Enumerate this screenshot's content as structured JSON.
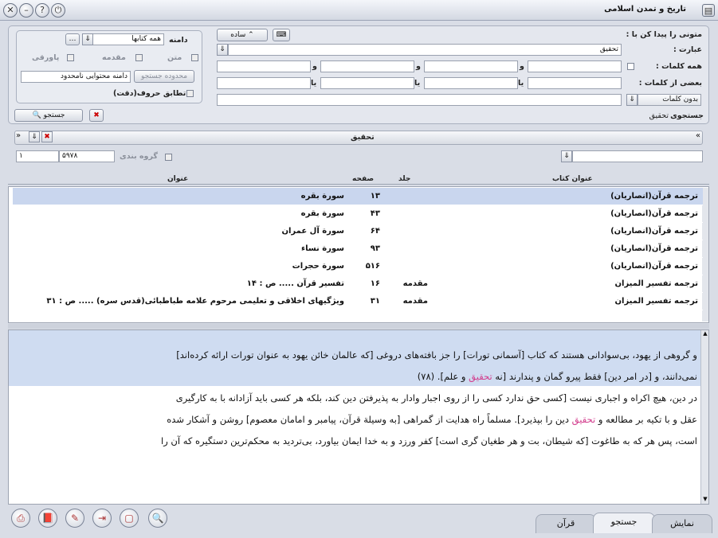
{
  "window": {
    "title": "تاریخ و تمدن اسلامی"
  },
  "search": {
    "find_texts_label": "متونی را پیدا کن با :",
    "simple_button": "ساده",
    "phrase_label": "عبارت :",
    "phrase_value": "تحقیق",
    "all_words_label": "همه کلمات :",
    "some_words_label": "بعضی از کلمات :",
    "without_words_label": "بدون کلمات",
    "and_word": "و",
    "or_word": "یا",
    "search_of_label": "جستجوی",
    "search_of_value": "تحقیق",
    "search_button": "جستجو"
  },
  "scope": {
    "scope_label": "دامنه",
    "scope_value": "همه کتابها",
    "text_label": "متن",
    "intro_label": "مقدمه",
    "footnote_label": "پاورقی",
    "limit_button": "محدوده جستجو",
    "content_scope": "دامنه محتوایی نامحدود",
    "exact_match_label": "تطابق حروف(دقت)"
  },
  "results": {
    "query_title": "تحقیق",
    "group_label": "گروه بندی",
    "count": "۵۹۷۸",
    "page": "۱",
    "headers": {
      "book_title": "عنوان کتاب",
      "volume": "جلد",
      "page": "صفحه",
      "title": "عنوان"
    },
    "rows": [
      {
        "book": "ترجمه قرآن(انصاریان)",
        "volume": "",
        "page": "۱۳",
        "title": "سورة بقره"
      },
      {
        "book": "ترجمه قرآن(انصاریان)",
        "volume": "",
        "page": "۴۳",
        "title": "سورة بقره"
      },
      {
        "book": "ترجمه قرآن(انصاریان)",
        "volume": "",
        "page": "۶۴",
        "title": "سورة آل عمران"
      },
      {
        "book": "ترجمه قرآن(انصاریان)",
        "volume": "",
        "page": "۹۳",
        "title": "سورة نساء"
      },
      {
        "book": "ترجمه قرآن(انصاریان)",
        "volume": "",
        "page": "۵۱۶",
        "title": "سورة حجرات"
      },
      {
        "book": "ترجمه تفسیر المیزان",
        "volume": "مقدمه",
        "page": "۱۶",
        "title": "تفسیر قرآن ..... ص : ۱۴"
      },
      {
        "book": "ترجمه تفسیر المیزان",
        "volume": "مقدمه",
        "page": "۳۱",
        "title": "ویژگیهای اخلاقی و تعلیمی مرحوم علامه طباطبائی(قدس سره) ..... ص : ۳۱"
      }
    ]
  },
  "preview": {
    "p1a": "و گروهی از یهود، بی‌سوادانی هستند که کتاب [آسمانی تورات] را جز بافته‌های دروغی [که عالمان خائن یهود به عنوان تورات ارائه کرده‌اند]",
    "p1b_pre": "نمی‌دانند، و [در امر دین] فقط پیرو گمان و پندارند [نه",
    "p1b_hl": "تحقیق",
    "p1b_post": "و علم]. (۷۸)",
    "p2a": "در دین، هیچ اکراه و اجباری نیست [کسی حق ندارد کسی را از روی اجبار وادار به پذیرفتن دین کند، بلکه هر کسی باید آزادانه با به کارگیری",
    "p2b_pre": "عقل و با تکیه بر مطالعه و",
    "p2b_hl": "تحقیق",
    "p2b_post": "دین را بپذیرد]. مسلماً راه هدایت از گمراهی [به وسیلة قرآن، پیامبر و امامان معصوم] روشن و آشکار شده",
    "p2c": "است، پس هر که به طاغوت [که شیطان، بت و هر طغیان گری است] کفر ورزد و به خدا ایمان بیاورد، بی‌تردید به محکم‌ترین دستگیره که آن را"
  },
  "tabs": {
    "display": "نمایش",
    "search": "جستجو",
    "quran": "قرآن"
  },
  "colors": {
    "selected_row": "#c9d6ee",
    "highlight": "#d23c8c",
    "preview_highlight": "#cfdcf1"
  }
}
